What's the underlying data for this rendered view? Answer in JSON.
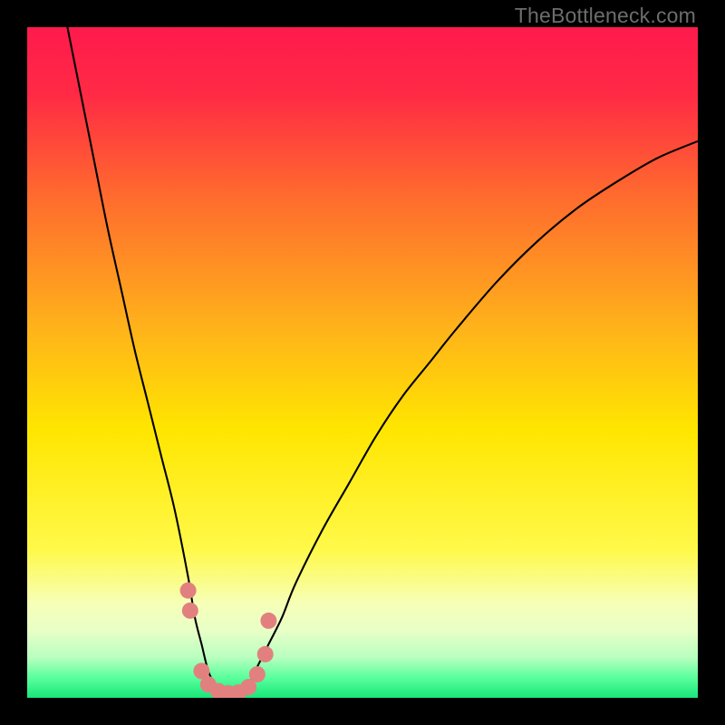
{
  "watermark": "TheBottleneck.com",
  "chart_data": {
    "type": "line",
    "title": "",
    "xlabel": "",
    "ylabel": "",
    "xlim": [
      0,
      100
    ],
    "ylim": [
      0,
      100
    ],
    "grid": false,
    "background": {
      "gradient": [
        {
          "offset": 0.0,
          "color": "#ff1a4d"
        },
        {
          "offset": 0.1,
          "color": "#ff2a45"
        },
        {
          "offset": 0.25,
          "color": "#ff6a2e"
        },
        {
          "offset": 0.45,
          "color": "#ffb31a"
        },
        {
          "offset": 0.6,
          "color": "#ffe600"
        },
        {
          "offset": 0.78,
          "color": "#fff94a"
        },
        {
          "offset": 0.86,
          "color": "#f6ffb8"
        },
        {
          "offset": 0.9,
          "color": "#e8ffc7"
        },
        {
          "offset": 0.94,
          "color": "#b8ffbf"
        },
        {
          "offset": 0.97,
          "color": "#5aff9c"
        },
        {
          "offset": 1.0,
          "color": "#18e67a"
        }
      ]
    },
    "series": [
      {
        "name": "bottleneck-curve",
        "stroke": "#000000",
        "strokeWidth": 2.1,
        "x": [
          6,
          8,
          10,
          12,
          14,
          16,
          18,
          20,
          22,
          24,
          25,
          26,
          27,
          28,
          29,
          30,
          31,
          32,
          33,
          34,
          36,
          38,
          40,
          44,
          48,
          52,
          56,
          60,
          64,
          70,
          76,
          82,
          88,
          94,
          100
        ],
        "y": [
          100,
          90,
          80,
          70,
          61,
          52,
          44,
          36,
          28,
          18,
          12,
          8,
          4,
          2,
          1,
          0.6,
          0.6,
          1,
          2,
          4,
          8,
          12,
          17,
          25,
          32,
          39,
          45,
          50,
          55,
          62,
          68,
          73,
          77,
          80.5,
          83
        ]
      }
    ],
    "markers": {
      "name": "highlight-dots",
      "color": "#e28080",
      "radius": 9,
      "points": [
        {
          "x": 24.0,
          "y": 16.0
        },
        {
          "x": 24.3,
          "y": 13.0
        },
        {
          "x": 26.0,
          "y": 4.0
        },
        {
          "x": 27.0,
          "y": 2.0
        },
        {
          "x": 28.5,
          "y": 1.0
        },
        {
          "x": 30.0,
          "y": 0.7
        },
        {
          "x": 31.5,
          "y": 0.8
        },
        {
          "x": 33.0,
          "y": 1.6
        },
        {
          "x": 34.3,
          "y": 3.5
        },
        {
          "x": 35.5,
          "y": 6.5
        },
        {
          "x": 36.0,
          "y": 11.5
        }
      ]
    }
  }
}
